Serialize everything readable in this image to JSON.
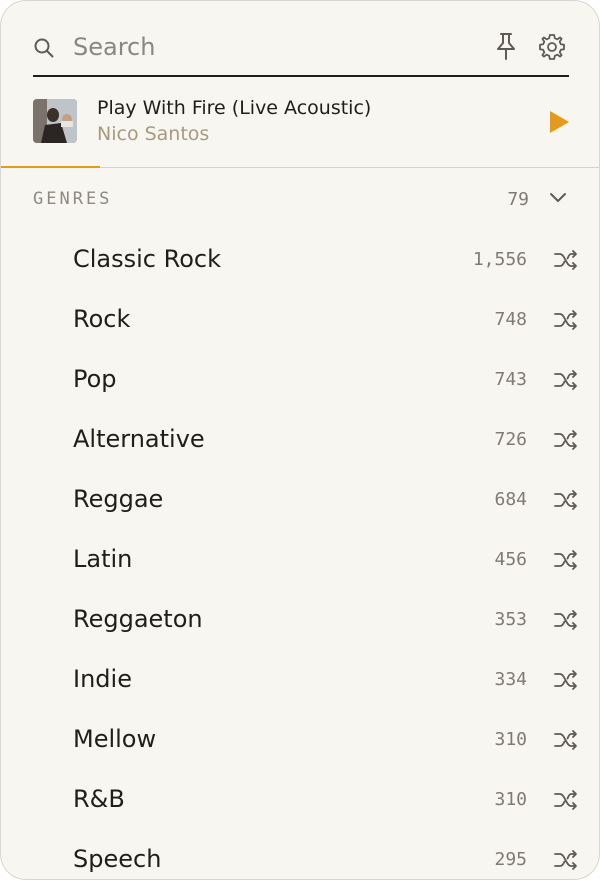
{
  "search": {
    "placeholder": "Search",
    "value": ""
  },
  "icons": {
    "search": "search-icon",
    "pin": "pin-icon",
    "settings": "gear-icon",
    "play": "play-icon",
    "collapse": "chevron-down-icon",
    "shuffle": "shuffle-icon"
  },
  "now_playing": {
    "title": "Play With Fire (Live Acoustic)",
    "artist": "Nico Santos",
    "progress": 0.165
  },
  "genres": {
    "header": "GENRES",
    "count": "79",
    "items": [
      {
        "name": "Classic Rock",
        "count": "1,556"
      },
      {
        "name": "Rock",
        "count": "748"
      },
      {
        "name": "Pop",
        "count": "743"
      },
      {
        "name": "Alternative",
        "count": "726"
      },
      {
        "name": "Reggae",
        "count": "684"
      },
      {
        "name": "Latin",
        "count": "456"
      },
      {
        "name": "Reggaeton",
        "count": "353"
      },
      {
        "name": "Indie",
        "count": "334"
      },
      {
        "name": "Mellow",
        "count": "310"
      },
      {
        "name": "R&B",
        "count": "310"
      },
      {
        "name": "Speech",
        "count": "295"
      }
    ]
  },
  "colors": {
    "accent": "#e39a1e",
    "background": "#f8f6f0",
    "text": "#1f1e1c",
    "muted": "#7f7b72",
    "artist": "#a79a80"
  }
}
